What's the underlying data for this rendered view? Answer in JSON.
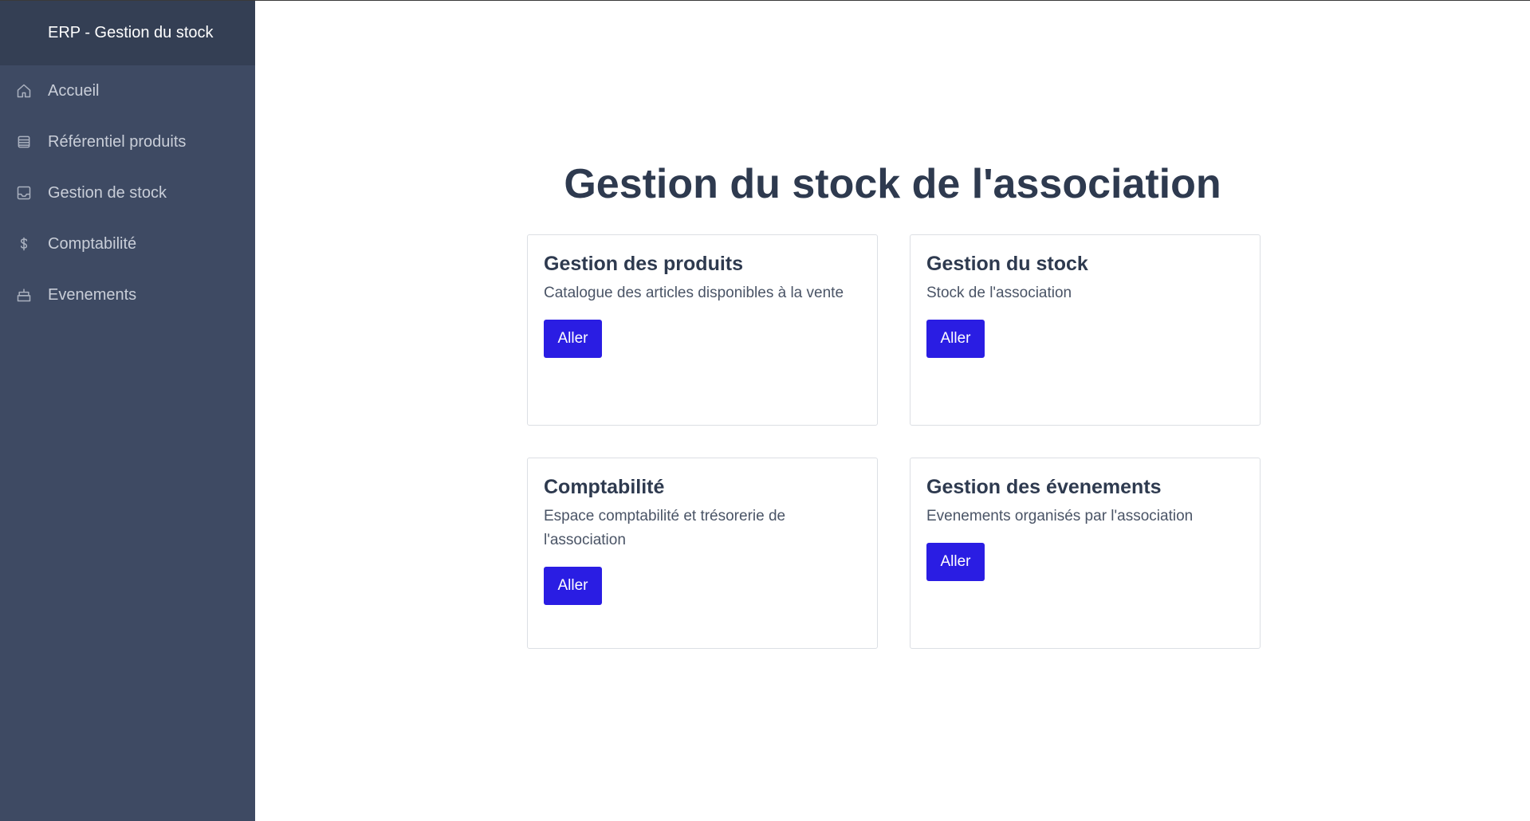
{
  "sidebar": {
    "brand": "ERP - Gestion du stock",
    "items": [
      {
        "label": "Accueil",
        "icon": "home-icon"
      },
      {
        "label": "Référentiel produits",
        "icon": "database-icon"
      },
      {
        "label": "Gestion de stock",
        "icon": "inbox-icon"
      },
      {
        "label": "Comptabilité",
        "icon": "dollar-icon"
      },
      {
        "label": "Evenements",
        "icon": "cake-icon"
      }
    ]
  },
  "main": {
    "title": "Gestion du stock de l'association",
    "cards": [
      {
        "title": "Gestion des produits",
        "text": "Catalogue des articles disponibles à la vente",
        "button": "Aller"
      },
      {
        "title": "Gestion du stock",
        "text": "Stock de l'association",
        "button": "Aller"
      },
      {
        "title": "Comptabilité",
        "text": "Espace comptabilité et trésorerie de l'association",
        "button": "Aller"
      },
      {
        "title": "Gestion des évenements",
        "text": "Evenements organisés par l'association",
        "button": "Aller"
      }
    ]
  },
  "colors": {
    "sidebar_bg": "#3e4a63",
    "brand_bg": "#343f54",
    "button": "#2a1de3",
    "title_text": "#2e3a4f"
  }
}
